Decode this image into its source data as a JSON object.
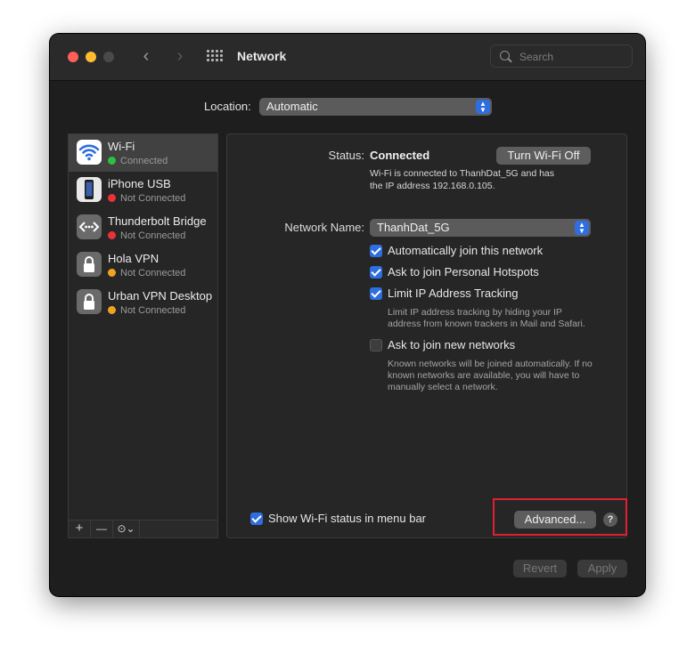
{
  "window": {
    "title": "Network",
    "search_placeholder": "Search",
    "nav_back": "‹",
    "nav_forward": "›"
  },
  "location": {
    "label": "Location:",
    "value": "Automatic"
  },
  "services": [
    {
      "name": "Wi-Fi",
      "status": "Connected",
      "status_color": "#2fbf40",
      "icon": "wifi-icon",
      "selected": true
    },
    {
      "name": "iPhone USB",
      "status": "Not Connected",
      "status_color": "#e8323a",
      "icon": "iphone-icon",
      "selected": false
    },
    {
      "name": "Thunderbolt Bridge",
      "status": "Not Connected",
      "status_color": "#e8323a",
      "icon": "thunderbolt-bridge-icon",
      "selected": false
    },
    {
      "name": "Hola VPN",
      "status": "Not Connected",
      "status_color": "#f0a320",
      "icon": "lock-icon",
      "selected": false
    },
    {
      "name": "Urban VPN Desktop",
      "status": "Not Connected",
      "status_color": "#f0a320",
      "icon": "lock-icon",
      "selected": false
    }
  ],
  "sidebar_tools": {
    "add": "+",
    "remove": "—",
    "action": "⊙⌄"
  },
  "detail": {
    "status_label": "Status:",
    "status_value": "Connected",
    "turn_off_button": "Turn Wi-Fi Off",
    "status_desc_line1": "Wi-Fi is connected to ThanhDat_5G and has",
    "status_desc_line2": "the IP address 192.168.0.105.",
    "network_name_label": "Network Name:",
    "network_name_value": "ThanhDat_5G",
    "options": [
      {
        "label": "Automatically join this network",
        "checked": true
      },
      {
        "label": "Ask to join Personal Hotspots",
        "checked": true
      },
      {
        "label": "Limit IP Address Tracking",
        "checked": true
      },
      {
        "label": "Ask to join new networks",
        "checked": false
      }
    ],
    "limit_desc_line1": "Limit IP address tracking by hiding your IP",
    "limit_desc_line2": "address from known trackers in Mail and Safari.",
    "new_networks_desc_line1": "Known networks will be joined automatically. If no",
    "new_networks_desc_line2": "known networks are available, you will have to",
    "new_networks_desc_line3": "manually select a network.",
    "show_menu_bar_label": "Show Wi-Fi status in menu bar",
    "show_menu_bar_checked": true,
    "advanced_button": "Advanced...",
    "help": "?"
  },
  "footer": {
    "revert": "Revert",
    "apply": "Apply"
  },
  "colors": {
    "accent": "#2f6ee0",
    "highlight_box": "#e0202f"
  }
}
